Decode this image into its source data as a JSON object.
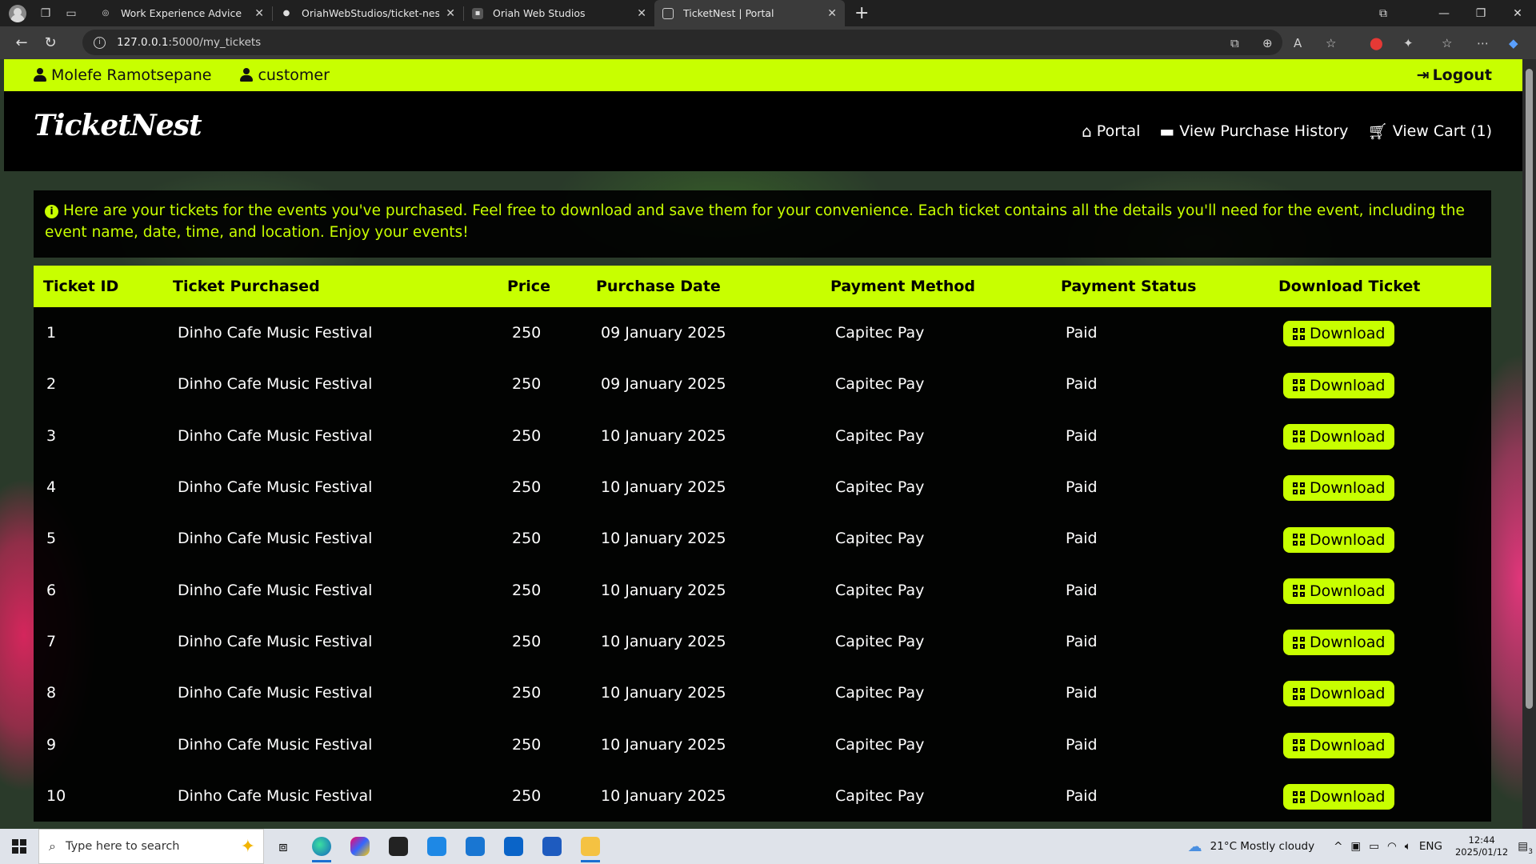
{
  "browser": {
    "tabs": [
      {
        "title": "Work Experience Advice",
        "active": false
      },
      {
        "title": "OriahWebStudios/ticket-nest",
        "active": false
      },
      {
        "title": "Oriah Web Studios",
        "active": false
      },
      {
        "title": "TicketNest | Portal",
        "active": true
      }
    ],
    "url_host": "127.0.0.1",
    "url_path": ":5000/my_tickets"
  },
  "topbar": {
    "username": "Molefe Ramotsepane",
    "role": "customer",
    "logout_label": "Logout"
  },
  "navbar": {
    "brand": "TicketNest",
    "links": [
      {
        "label": "Portal",
        "icon": "home-icon"
      },
      {
        "label": "View Purchase History",
        "icon": "ticket-icon"
      },
      {
        "label": "View Cart (1)",
        "icon": "cart-icon"
      }
    ]
  },
  "notice": {
    "text": "Here are your tickets for the events you've purchased. Feel free to download and save them for your convenience. Each ticket contains all the details you'll need for the event, including the event name, date, time, and location. Enjoy your events!"
  },
  "table": {
    "columns": [
      "Ticket ID",
      "Ticket Purchased",
      "Price",
      "Purchase Date",
      "Payment Method",
      "Payment Status",
      "Download Ticket"
    ],
    "rows": [
      {
        "id": "1",
        "event": "Dinho Cafe Music Festival",
        "price": "250",
        "date": "09 January 2025",
        "method": "Capitec Pay",
        "status": "Paid",
        "action": "Download"
      },
      {
        "id": "2",
        "event": "Dinho Cafe Music Festival",
        "price": "250",
        "date": "09 January 2025",
        "method": "Capitec Pay",
        "status": "Paid",
        "action": "Download"
      },
      {
        "id": "3",
        "event": "Dinho Cafe Music Festival",
        "price": "250",
        "date": "10 January 2025",
        "method": "Capitec Pay",
        "status": "Paid",
        "action": "Download"
      },
      {
        "id": "4",
        "event": "Dinho Cafe Music Festival",
        "price": "250",
        "date": "10 January 2025",
        "method": "Capitec Pay",
        "status": "Paid",
        "action": "Download"
      },
      {
        "id": "5",
        "event": "Dinho Cafe Music Festival",
        "price": "250",
        "date": "10 January 2025",
        "method": "Capitec Pay",
        "status": "Paid",
        "action": "Download"
      },
      {
        "id": "6",
        "event": "Dinho Cafe Music Festival",
        "price": "250",
        "date": "10 January 2025",
        "method": "Capitec Pay",
        "status": "Paid",
        "action": "Download"
      },
      {
        "id": "7",
        "event": "Dinho Cafe Music Festival",
        "price": "250",
        "date": "10 January 2025",
        "method": "Capitec Pay",
        "status": "Paid",
        "action": "Download"
      },
      {
        "id": "8",
        "event": "Dinho Cafe Music Festival",
        "price": "250",
        "date": "10 January 2025",
        "method": "Capitec Pay",
        "status": "Paid",
        "action": "Download"
      },
      {
        "id": "9",
        "event": "Dinho Cafe Music Festival",
        "price": "250",
        "date": "10 January 2025",
        "method": "Capitec Pay",
        "status": "Paid",
        "action": "Download"
      },
      {
        "id": "10",
        "event": "Dinho Cafe Music Festival",
        "price": "250",
        "date": "10 January 2025",
        "method": "Capitec Pay",
        "status": "Paid",
        "action": "Download"
      }
    ]
  },
  "taskbar": {
    "search_placeholder": "Type here to search",
    "weather": "21°C  Mostly cloudy",
    "language": "ENG",
    "time": "12:44",
    "date": "2025/01/12",
    "notification_count": "3"
  },
  "colors": {
    "accent": "#c8ff00",
    "navbar": "#000000"
  }
}
